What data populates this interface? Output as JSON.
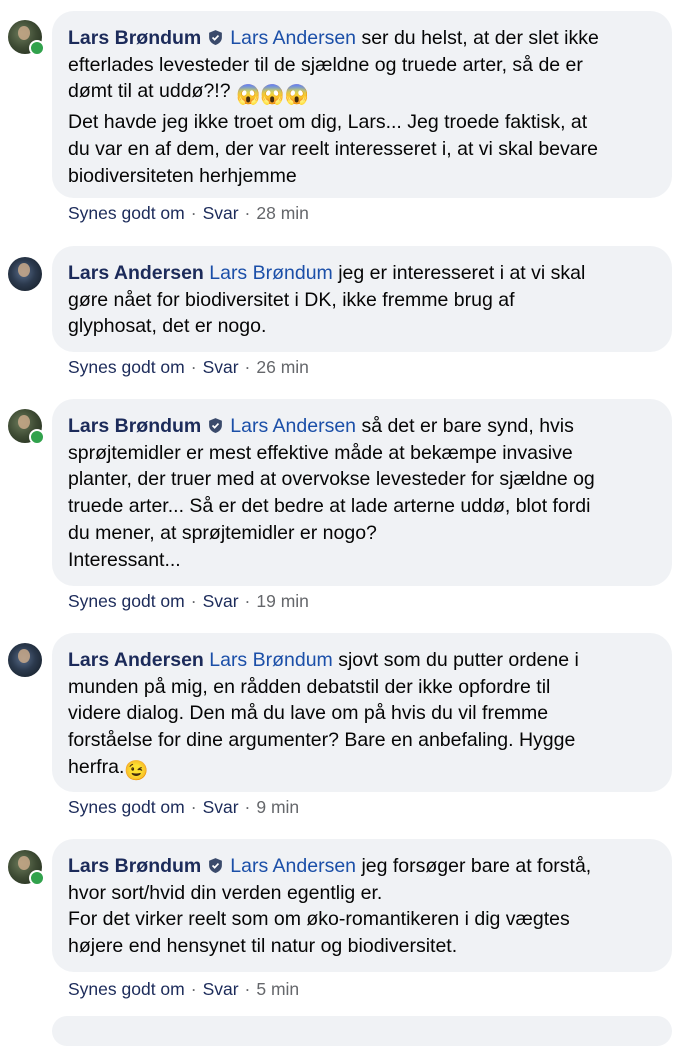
{
  "actions": {
    "like": "Synes godt om",
    "reply": "Svar",
    "sep": "·"
  },
  "comments": [
    {
      "author": "Lars Brøndum",
      "mention": "Lars Andersen",
      "lines": [
        " ser du helst, at der slet ikke",
        "efterlades levesteder til de sjældne og truede arter, så de er",
        "dømt til at uddø?!? ",
        "Det havde jeg ikke troet om dig, Lars... Jeg troede faktisk, at",
        "du var en af dem, der var reelt interesseret i, at vi skal bevare",
        "biodiversiteten herhjemme"
      ],
      "emoji": "😱😱😱",
      "time": "28 min"
    },
    {
      "author": "Lars Andersen",
      "mention": "Lars Brøndum",
      "lines": [
        " jeg er interesseret i at vi skal",
        "gøre nået for biodiversitet i DK, ikke fremme brug af",
        "glyphosat, det er nogo."
      ],
      "time": "26 min"
    },
    {
      "author": "Lars Brøndum",
      "mention": "Lars Andersen",
      "lines": [
        " så det er bare synd, hvis",
        "sprøjtemidler er mest effektive måde at bekæmpe invasive",
        "planter, der truer med at overvokse levesteder for sjældne og",
        "truede arter... Så er det bedre at lade arterne uddø, blot fordi",
        "du mener, at sprøjtemidler er nogo?",
        "Interessant..."
      ],
      "time": "19 min"
    },
    {
      "author": "Lars Andersen",
      "mention": "Lars Brøndum",
      "lines": [
        " sjovt som du putter ordene i",
        "munden på mig, en rådden debatstil der ikke opfordre til",
        "videre dialog. Den må du lave om på hvis du vil fremme",
        "forståelse for dine argumenter? Bare en anbefaling. Hygge",
        "herfra."
      ],
      "emoji": "😉",
      "time": "9 min"
    },
    {
      "author": "Lars Brøndum",
      "mention": "Lars Andersen",
      "lines": [
        " jeg forsøger bare at forstå,",
        "hvor sort/hvid din verden egentlig er.",
        "For det virker reelt som om øko-romantikeren i dig vægtes",
        "højere end hensynet til natur og biodiversitet."
      ],
      "time": "5 min"
    }
  ]
}
